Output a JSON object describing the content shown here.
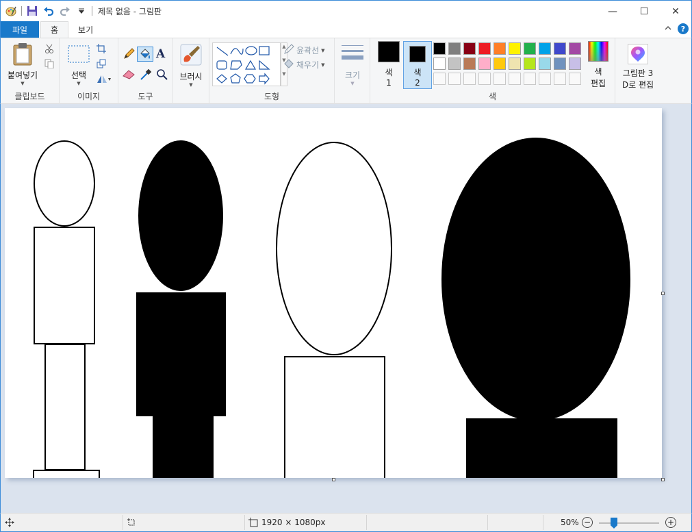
{
  "titlebar": {
    "title": "제목 없음 - 그림판",
    "minimize": "—",
    "maximize": "☐",
    "close": "✕"
  },
  "tabs": {
    "file": "파일",
    "home": "홈",
    "view": "보기"
  },
  "ribbon": {
    "clipboard": {
      "paste": "붙여넣기",
      "label": "클립보드"
    },
    "image": {
      "select": "선택",
      "label": "이미지"
    },
    "tools": {
      "label": "도구",
      "text_glyph": "A"
    },
    "brushes": {
      "label": "브러시"
    },
    "shapes": {
      "outline": "윤곽선",
      "fill": "채우기",
      "label": "도형"
    },
    "size": {
      "label": "크기"
    },
    "colors": {
      "color1_line1": "색",
      "color1_line2": "1",
      "color2_line1": "색",
      "color2_line2": "2",
      "edit_line1": "색",
      "edit_line2": "편집",
      "label": "색",
      "color1": "#000000",
      "color2": "#000000",
      "palette_row1": [
        "#000000",
        "#7f7f7f",
        "#880015",
        "#ed1c24",
        "#ff7f27",
        "#fff200",
        "#22b14c",
        "#00a2e8",
        "#3f48cc",
        "#a349a4"
      ],
      "palette_row2": [
        "#ffffff",
        "#c3c3c3",
        "#b97a57",
        "#ffaec9",
        "#ffc90e",
        "#efe4b0",
        "#b5e61d",
        "#99d9ea",
        "#7092be",
        "#c8bfe7"
      ]
    },
    "paint3d": {
      "line1": "그림판 3",
      "line2": "D로 편집"
    }
  },
  "statusbar": {
    "dimensions": "1920 × 1080px",
    "zoom": "50%",
    "zoom_out": "−",
    "zoom_in": "+"
  }
}
